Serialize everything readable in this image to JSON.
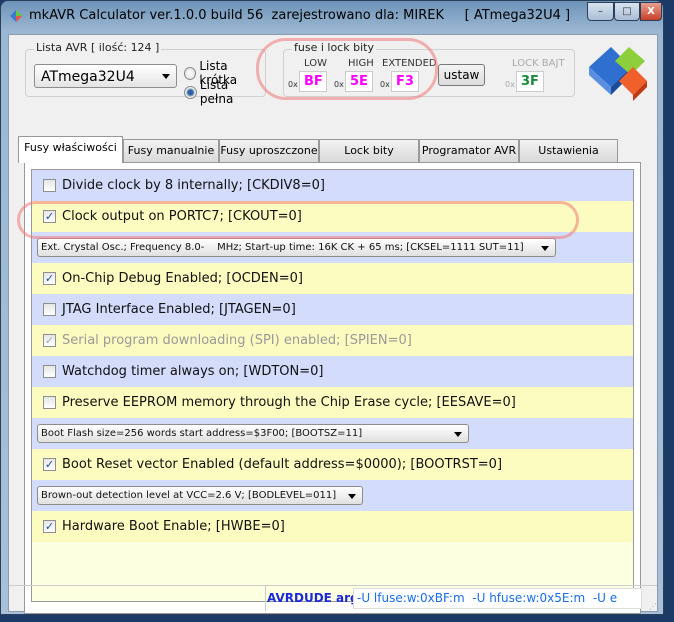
{
  "window": {
    "title": "mkAVR Calculator ver.1.0.0 build 56  zarejestrowano dla: MIREK     [ ATmega32U4 ]",
    "minimize": "–",
    "maximize": "□",
    "close": "X"
  },
  "avr_list": {
    "label": "Lista AVR [ ilość: 124 ]",
    "selected": "ATmega32U4",
    "radio_short": "Lista krótka",
    "radio_full": "Lista pełna"
  },
  "fuses": {
    "label": "fuse i lock bity",
    "low_label": "LOW",
    "high_label": "HIGH",
    "ext_label": "EXTENDED",
    "prefix": "0x",
    "low": "BF",
    "high": "5E",
    "ext": "F3",
    "set_button": "ustaw",
    "lock_label": "LOCK BAJT",
    "lock": "3F",
    "accent": "#ff00ff",
    "lock_color": "#1a8a3a"
  },
  "tabs": [
    "Fusy właściwości",
    "Fusy manualnie",
    "Fusy uproszczone",
    "Lock bity",
    "Programator AVR",
    "Ustawienia"
  ],
  "rows": [
    {
      "type": "check",
      "checked": false,
      "label": "Divide clock by 8 internally; [CKDIV8=0]"
    },
    {
      "type": "check",
      "checked": true,
      "label": "Clock output on PORTC7; [CKOUT=0]"
    },
    {
      "type": "select",
      "label": "Ext. Crystal Osc.; Frequency 8.0-    MHz; Start-up time: 16K CK + 65 ms; [CKSEL=1111 SUT=11]"
    },
    {
      "type": "check",
      "checked": true,
      "label": "On-Chip Debug Enabled; [OCDEN=0]"
    },
    {
      "type": "check",
      "checked": false,
      "label": "JTAG Interface Enabled; [JTAGEN=0]"
    },
    {
      "type": "check",
      "checked": true,
      "disabled": true,
      "label": "Serial program downloading (SPI) enabled; [SPIEN=0]"
    },
    {
      "type": "check",
      "checked": false,
      "label": "Watchdog timer always on; [WDTON=0]"
    },
    {
      "type": "check",
      "checked": false,
      "label": "Preserve EEPROM memory through the Chip Erase cycle; [EESAVE=0]"
    },
    {
      "type": "select",
      "label": "Boot Flash size=256 words start address=$3F00; [BOOTSZ=11]"
    },
    {
      "type": "check",
      "checked": true,
      "label": "Boot Reset vector Enabled (default address=$0000); [BOOTRST=0]"
    },
    {
      "type": "select",
      "label": "Brown-out detection level at VCC=2.6 V; [BODLEVEL=011]"
    },
    {
      "type": "check",
      "checked": true,
      "label": "Hardware Boot Enable;  [HWBE=0]"
    }
  ],
  "status": {
    "label": "AVRDUDE arg.",
    "value": "-U lfuse:w:0xBF:m  -U hfuse:w:0x5E:m  -U e"
  }
}
